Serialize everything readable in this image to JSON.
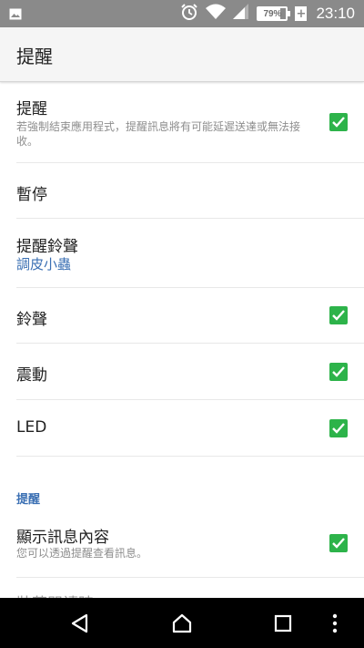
{
  "status_bar": {
    "time": "23:10",
    "battery": "79%",
    "battery_level": 0.79,
    "icons": [
      "image-icon",
      "alarm-icon",
      "wifi-icon",
      "signal-icon",
      "battery-icon",
      "charging-icon"
    ]
  },
  "app_bar": {
    "title": "提醒"
  },
  "settings": {
    "notify": {
      "label": "提醒",
      "description": "若強制結束應用程式，提醒訊息將有可能延遲送達或無法接收。",
      "checked": true
    },
    "pause": {
      "label": "暫停"
    },
    "ringtone": {
      "label": "提醒鈴聲",
      "value": "調皮小蟲"
    },
    "sound": {
      "label": "鈴聲",
      "checked": true
    },
    "vibrate": {
      "label": "震動",
      "checked": true
    },
    "led": {
      "label": "LED",
      "checked": true
    },
    "section_header": "提醒",
    "show_content": {
      "label": "顯示訊息內容",
      "description": "您可以透過提醒查看訊息。",
      "checked": true
    },
    "partial_next": "裝蓋閱讀時"
  },
  "colors": {
    "status_bar_bg": "#8a8a8a",
    "app_bar_bg": "#f5f5f5",
    "checkbox": "#2db34a",
    "accent_blue": "#3a6fb3",
    "nav_bar_bg": "#000000"
  },
  "nav_bar": {
    "icons": [
      "back-icon",
      "home-icon",
      "recents-icon",
      "more-icon"
    ]
  }
}
